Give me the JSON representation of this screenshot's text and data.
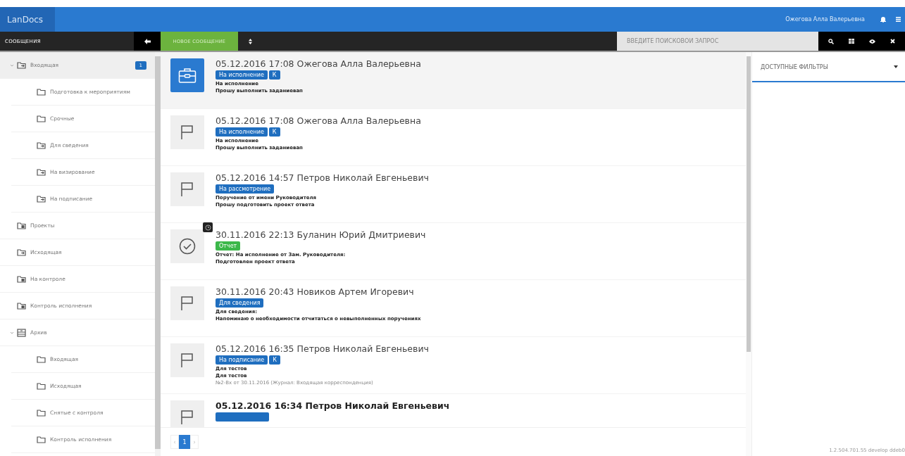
{
  "header": {
    "logo": "LanDocs",
    "user": "Ожегова Алла Валерьевна"
  },
  "toolbar": {
    "section_title": "СООБЩЕНИЯ",
    "new_button": "НОВОЕ СООБЩЕНИЕ",
    "search": {
      "placeholder": "ВВЕДИТЕ ПОИСКОВОЙ ЗАПРОС"
    }
  },
  "sidebar": {
    "items": [
      {
        "label": "Входящая",
        "kind": "inbox",
        "selected": true,
        "expanded": true,
        "badge": "1",
        "children": [
          {
            "label": "Подготовка к мероприятиям",
            "kind": "folder",
            "selected": false
          },
          {
            "label": "Срочные",
            "kind": "folder",
            "selected": false
          },
          {
            "label": "Для сведения",
            "kind": "inbox",
            "selected": false
          },
          {
            "label": "На визирование",
            "kind": "inbox",
            "selected": false
          },
          {
            "label": "На подписание",
            "kind": "inbox",
            "selected": false
          }
        ]
      },
      {
        "label": "Проекты",
        "kind": "project",
        "selected": false
      },
      {
        "label": "Исходящая",
        "kind": "inbox",
        "selected": false
      },
      {
        "label": "На контроле",
        "kind": "project",
        "selected": false
      },
      {
        "label": "Контроль исполнения",
        "kind": "project",
        "selected": false
      },
      {
        "label": "Архив",
        "kind": "archive",
        "selected": false,
        "expanded": true,
        "children": [
          {
            "label": "Входящая",
            "kind": "folder",
            "selected": false
          },
          {
            "label": "Исходящая",
            "kind": "folder",
            "selected": false
          },
          {
            "label": "Снятые с контроля",
            "kind": "folder",
            "selected": false
          },
          {
            "label": "Контроль исполнения",
            "kind": "folder",
            "selected": false
          }
        ]
      }
    ]
  },
  "messages": [
    {
      "title": "05.12.2016 17:08 Ожегова Алла Валерьевна",
      "kind": "task",
      "selected": true,
      "unread": false,
      "alert": false,
      "badges": [
        {
          "label": "На исполнение",
          "color": "#1f6ebf"
        },
        {
          "label": "К",
          "color": "#1f6ebf"
        }
      ],
      "lines": [
        "На исполнение",
        "Прошу выполнить заданиевап"
      ]
    },
    {
      "title": "05.12.2016 17:08 Ожегова Алла Валерьевна",
      "kind": "flag",
      "selected": false,
      "unread": false,
      "alert": false,
      "badges": [
        {
          "label": "На исполнение",
          "color": "#1f6ebf"
        },
        {
          "label": "К",
          "color": "#1f6ebf"
        }
      ],
      "lines": [
        "На исполнение",
        "Прошу выполнить заданиевап"
      ]
    },
    {
      "title": "05.12.2016 14:57 Петров Николай Евгеньевич",
      "kind": "flag",
      "selected": false,
      "unread": false,
      "alert": false,
      "badges": [
        {
          "label": "На рассмотрение",
          "color": "#1f6ebf"
        }
      ],
      "lines": [
        "Поручение от имени Руководителя",
        "Прошу подготовить проект ответа"
      ]
    },
    {
      "title": "30.11.2016 22:13 Буланин Юрий Дмитриевич",
      "kind": "report",
      "selected": false,
      "unread": false,
      "alert": true,
      "badges": [
        {
          "label": "Отчет",
          "color": "#3cb84a"
        }
      ],
      "lines": [
        "Отчет: На исполнение от Зам. Руководителя:",
        "Подготовлен проект ответа"
      ]
    },
    {
      "title": "30.11.2016 20:43 Новиков Артем Игоревич",
      "kind": "flag",
      "selected": false,
      "unread": false,
      "alert": false,
      "badges": [
        {
          "label": "Для сведения",
          "color": "#1f6ebf"
        }
      ],
      "lines": [
        "Для сведения:",
        "Напоминаю о необходимости отчитаться о невыполненных поручениях"
      ]
    },
    {
      "title": "05.12.2016 16:35 Петров Николай Евгеньевич",
      "kind": "flag",
      "selected": false,
      "unread": false,
      "alert": false,
      "badges": [
        {
          "label": "На подписание",
          "color": "#1f6ebf"
        },
        {
          "label": "К",
          "color": "#1f6ebf"
        }
      ],
      "lines": [
        "Для тестов",
        "Для тестов"
      ],
      "note": "№2-Вх от 30.11.2016 (Журнал: Входящая корреспонденция)"
    },
    {
      "title": "05.12.2016 16:34 Петров Николай Евгеньевич",
      "kind": "flag",
      "selected": false,
      "unread": true,
      "alert": false,
      "badges": [
        {
          "color": "#1f6ebf"
        }
      ]
    }
  ],
  "pagination": {
    "prev": "‹",
    "next": "›",
    "pages": [
      {
        "label": "1",
        "selected": true
      }
    ]
  },
  "filters": {
    "title": "ДОСТУПНЫЕ ФИЛЬТРЫ"
  },
  "version": "1.2.504.701.55 develop ddeb0"
}
